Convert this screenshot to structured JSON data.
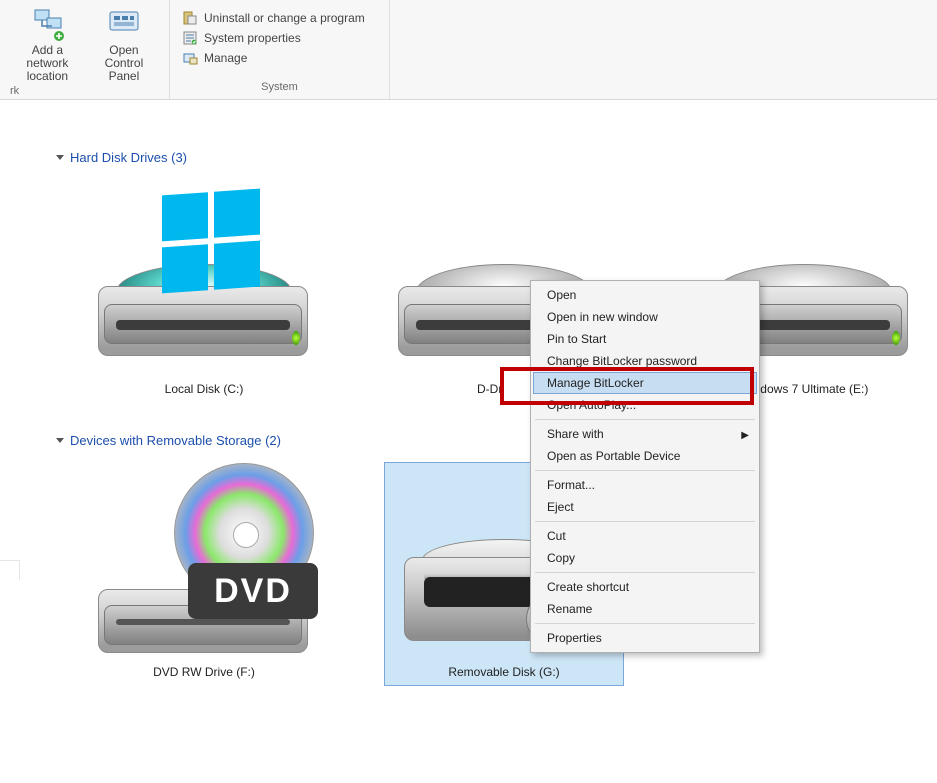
{
  "ribbon": {
    "groups": [
      {
        "caption": "rk",
        "big_buttons": [
          {
            "label": "Add a network\nlocation"
          },
          {
            "label": "Open Control\nPanel"
          }
        ]
      },
      {
        "caption": "System",
        "small_buttons": [
          {
            "label": "Uninstall or change a program"
          },
          {
            "label": "System properties"
          },
          {
            "label": "Manage"
          }
        ]
      }
    ]
  },
  "sections": [
    {
      "title": "Hard Disk Drives (3)",
      "items": [
        {
          "label": "Local Disk (C:)",
          "kind": "system-drive"
        },
        {
          "label": "D-Dr",
          "kind": "hdd",
          "partial": true
        },
        {
          "label": "Windows 7 Ultimate (E:)",
          "kind": "hdd"
        }
      ]
    },
    {
      "title": "Devices with Removable Storage (2)",
      "items": [
        {
          "label": "DVD RW Drive (F:)",
          "kind": "dvd"
        },
        {
          "label": "Removable Disk (G:)",
          "kind": "usb",
          "selected": true
        }
      ]
    }
  ],
  "context_menu": {
    "groups": [
      [
        {
          "label": "Open"
        },
        {
          "label": "Open in new window"
        },
        {
          "label": "Pin to Start"
        },
        {
          "label": "Change BitLocker password"
        },
        {
          "label": "Manage BitLocker",
          "highlighted": true
        },
        {
          "label": "Open AutoPlay..."
        }
      ],
      [
        {
          "label": "Share with",
          "submenu": true
        },
        {
          "label": "Open as Portable Device"
        }
      ],
      [
        {
          "label": "Format..."
        },
        {
          "label": "Eject"
        }
      ],
      [
        {
          "label": "Cut"
        },
        {
          "label": "Copy"
        }
      ],
      [
        {
          "label": "Create shortcut"
        },
        {
          "label": "Rename"
        }
      ],
      [
        {
          "label": "Properties"
        }
      ]
    ]
  }
}
